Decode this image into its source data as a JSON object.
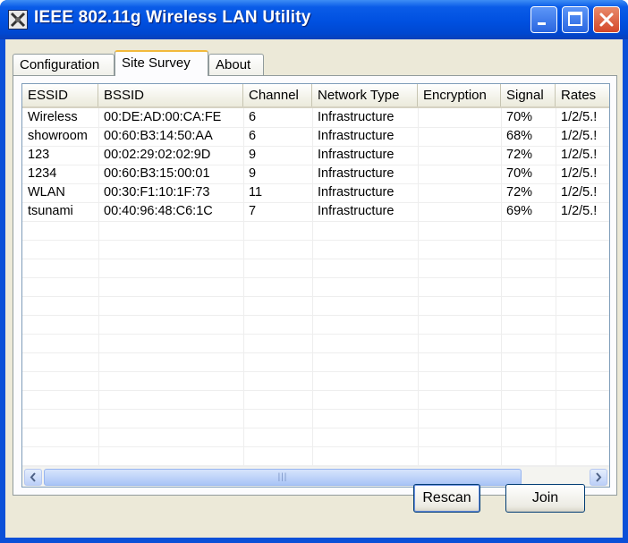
{
  "window": {
    "title": "IEEE 802.11g Wireless LAN Utility"
  },
  "tabs": [
    {
      "label": "Configuration",
      "active": false
    },
    {
      "label": "Site Survey",
      "active": true
    },
    {
      "label": "About",
      "active": false
    }
  ],
  "table": {
    "columns": [
      "ESSID",
      "BSSID",
      "Channel",
      "Network Type",
      "Encryption",
      "Signal",
      "Rates"
    ],
    "rows": [
      [
        "Wireless",
        "00:DE:AD:00:CA:FE",
        "6",
        "Infrastructure",
        "",
        "70%",
        "1/2/5.!"
      ],
      [
        "showroom",
        "00:60:B3:14:50:AA",
        "6",
        "Infrastructure",
        "",
        "68%",
        "1/2/5.!"
      ],
      [
        "123",
        "00:02:29:02:02:9D",
        "9",
        "Infrastructure",
        "",
        "72%",
        "1/2/5.!"
      ],
      [
        "1234",
        "00:60:B3:15:00:01",
        "9",
        "Infrastructure",
        "",
        "70%",
        "1/2/5.!"
      ],
      [
        "WLAN",
        "00:30:F1:10:1F:73",
        "11",
        "Infrastructure",
        "",
        "72%",
        "1/2/5.!"
      ],
      [
        "tsunami",
        "00:40:96:48:C6:1C",
        "7",
        "Infrastructure",
        "",
        "69%",
        "1/2/5.!"
      ]
    ]
  },
  "buttons": {
    "rescan": "Rescan",
    "join": "Join"
  },
  "colors": {
    "titlebar": "#0050e0",
    "close_button": "#d4482a",
    "dialog_face": "#ece9d8",
    "active_tab_highlight": "#f2b93c"
  },
  "icons": {
    "app": "wireless-utility-icon",
    "minimize": "minimize-icon",
    "maximize": "maximize-icon",
    "close": "close-icon",
    "scroll_left": "arrow-left-icon",
    "scroll_right": "arrow-right-icon"
  }
}
